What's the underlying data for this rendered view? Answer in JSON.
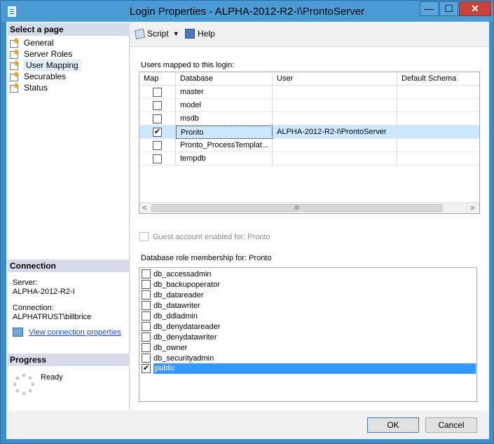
{
  "window": {
    "title": "Login Properties - ALPHA-2012-R2-I\\ProntoServer",
    "minimize": "—",
    "maximize": "☐",
    "close": "✕"
  },
  "left": {
    "select_page_header": "Select a page",
    "pages": [
      "General",
      "Server Roles",
      "User Mapping",
      "Securables",
      "Status"
    ],
    "selected_page": "User Mapping",
    "connection_header": "Connection",
    "server_label": "Server:",
    "server_value": "ALPHA-2012-R2-I",
    "connection_label": "Connection:",
    "connection_value": "ALPHATRUST\\billbrice",
    "view_link": "View connection properties",
    "progress_header": "Progress",
    "progress_status": "Ready"
  },
  "toolbar": {
    "script_label": "Script",
    "help_label": "Help"
  },
  "users": {
    "label": "Users mapped to this login:",
    "columns": [
      "Map",
      "Database",
      "User",
      "Default Schema"
    ],
    "rows": [
      {
        "map": false,
        "database": "master",
        "user": "",
        "schema": ""
      },
      {
        "map": false,
        "database": "model",
        "user": "",
        "schema": ""
      },
      {
        "map": false,
        "database": "msdb",
        "user": "",
        "schema": ""
      },
      {
        "map": true,
        "database": "Pronto",
        "user": "ALPHA-2012-R2-I\\ProntoServer",
        "schema": ""
      },
      {
        "map": false,
        "database": "Pronto_ProcessTemplat...",
        "user": "",
        "schema": ""
      },
      {
        "map": false,
        "database": "tempdb",
        "user": "",
        "schema": ""
      }
    ],
    "selected_row": 3,
    "scroll_grip": "III"
  },
  "guest": {
    "label": "Guest account enabled for: Pronto",
    "checked": false
  },
  "roles": {
    "label": "Database role membership for: Pronto",
    "items": [
      {
        "name": "db_accessadmin",
        "checked": false
      },
      {
        "name": "db_backupoperator",
        "checked": false
      },
      {
        "name": "db_datareader",
        "checked": false
      },
      {
        "name": "db_datawriter",
        "checked": false
      },
      {
        "name": "db_ddladmin",
        "checked": false
      },
      {
        "name": "db_denydatareader",
        "checked": false
      },
      {
        "name": "db_denydatawriter",
        "checked": false
      },
      {
        "name": "db_owner",
        "checked": false
      },
      {
        "name": "db_securityadmin",
        "checked": false
      },
      {
        "name": "public",
        "checked": true
      }
    ],
    "selected_item": "public"
  },
  "buttons": {
    "ok": "OK",
    "cancel": "Cancel"
  }
}
